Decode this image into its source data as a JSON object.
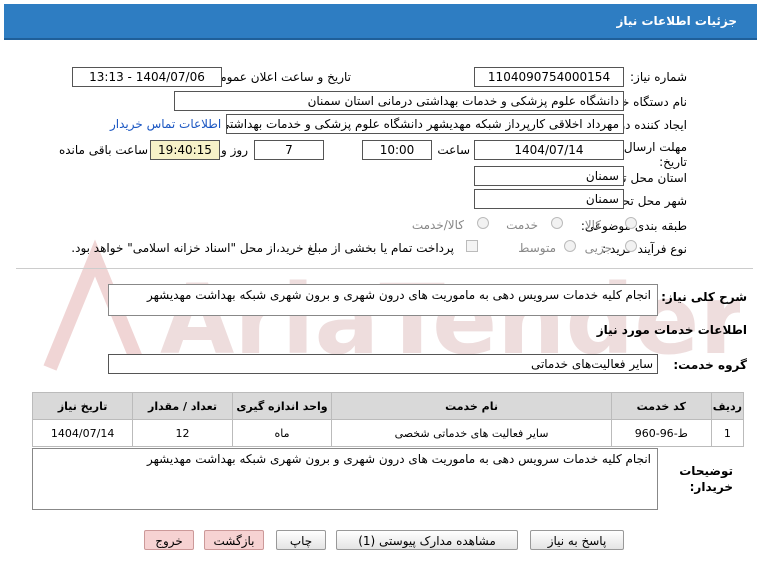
{
  "header": {
    "title": "جزئیات اطلاعات نیاز"
  },
  "fields": {
    "need_number_label": "شماره نیاز:",
    "need_number": "1104090754000154",
    "announce_label": "تاریخ و ساعت اعلان عمومی:",
    "announce_value": "1404/07/06 - 13:13",
    "buyer_org_label": "نام دستگاه خریدار:",
    "buyer_org": "دانشگاه علوم پزشکی و خدمات بهداشتی  درمانی استان سمنان",
    "creator_label": "ایجاد کننده درخواست:",
    "creator": "مهرداد اخلاقی کارپرداز شبکه مهدیشهر دانشگاه علوم پزشکی و خدمات بهداشتی",
    "contact_link": "اطلاعات تماس خریدار",
    "deadline_label_line1": "مهلت ارسال پاسخ: تا",
    "deadline_label_line2": "تاریخ:",
    "deadline_date": "1404/07/14",
    "time_label": "ساعت",
    "deadline_time": "10:00",
    "days_value": "7",
    "days_label": "روز و",
    "remaining_time": "19:40:15",
    "remaining_label": "ساعت باقی مانده",
    "province_label": "استان محل تحویل:",
    "province": "سمنان",
    "city_label": "شهر محل تحویل:",
    "city": "سمنان",
    "category_label": "طبقه بندی موضوعی:",
    "category_options": [
      "کالا",
      "خدمت",
      "کالا/خدمت"
    ],
    "process_label": "نوع فرآیند خرید :",
    "process_options": [
      "جزیی",
      "متوسط"
    ],
    "payment_note": "پرداخت تمام یا بخشی از مبلغ خرید،از محل \"اسناد خزانه اسلامی\" خواهد بود."
  },
  "summary": {
    "label": "شرح کلی نیاز:",
    "text": "انجام کلیه خدمات سرویس دهی به ماموریت های درون شهری و برون شهری شبکه بهداشت مهدیشهر"
  },
  "services": {
    "section_title": "اطلاعات خدمات مورد نیاز",
    "group_label": "گروه خدمت:",
    "group_value": "سایر فعالیت‌های خدماتی",
    "columns": [
      "ردیف",
      "کد خدمت",
      "نام خدمت",
      "واحد اندازه گیری",
      "تعداد / مقدار",
      "تاریخ نیاز"
    ],
    "rows": [
      {
        "row": "1",
        "code": "ط-96-960",
        "name": "سایر فعالیت های خدماتی شخصی",
        "unit": "ماه",
        "qty": "12",
        "date": "1404/07/14"
      }
    ]
  },
  "buyer_notes": {
    "label_line1": "توضیحات",
    "label_line2": "خریدار:",
    "text": "انجام کلیه خدمات سرویس دهی به ماموریت های درون شهری و برون شهری شبکه بهداشت مهدیشهر"
  },
  "buttons": {
    "reply": "پاسخ به نیاز",
    "attachments": "مشاهده مدارک پیوستی (1)",
    "print": "چاپ",
    "back": "بازگشت",
    "exit": "خروج"
  },
  "watermark_text": "AriaTender.net",
  "colors": {
    "header_bg": "#2e7dc2",
    "link": "#1a56c2",
    "remaining_bg": "#f6f1c8"
  }
}
